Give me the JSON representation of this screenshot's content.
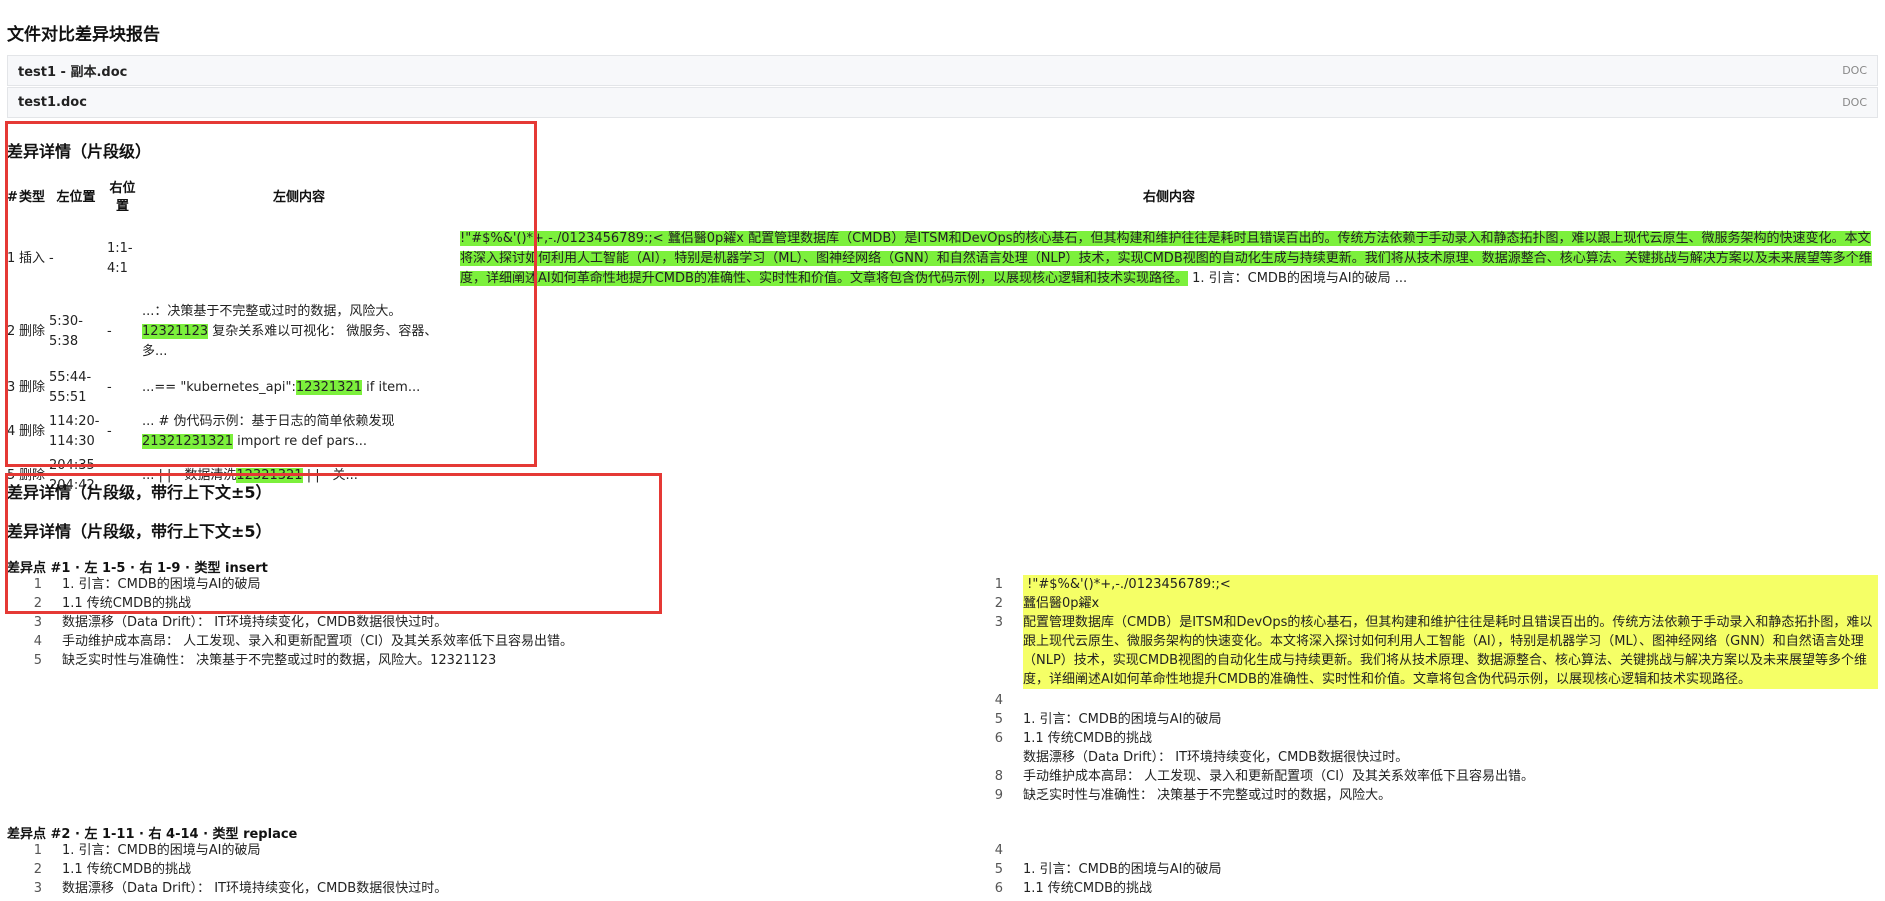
{
  "report": {
    "title": "文件对比差异块报告"
  },
  "files": [
    {
      "name": "test1 - 副本.doc",
      "type": "DOC"
    },
    {
      "name": "test1.doc",
      "type": "DOC"
    }
  ],
  "section1": {
    "title": "差异详情（片段级）",
    "headers": {
      "num": "#",
      "type": "类型",
      "left_pos": "左位置",
      "right_pos": "右位置",
      "left_content": "左侧内容",
      "right_content": "右侧内容"
    },
    "rows": [
      {
        "num": "1",
        "type": "插入",
        "left_pos": "-",
        "right_pos": "1:1-4:1",
        "left_pre": "",
        "left_hl": "",
        "left_post": "",
        "right_hl": "!\"#$%&'()*+,-./0123456789:;< 蠶侣醫0p糴x 配置管理数据库（CMDB）是ITSM和DevOps的核心基石，但其构建和维护往往是耗时且错误百出的。传统方法依赖于手动录入和静态拓扑图，难以跟上现代云原生、微服务架构的快速变化。本文将深入探讨如何利用人工智能（AI），特别是机器学习（ML）、图神经网络（GNN）和自然语言处理（NLP）技术，实现CMDB视图的自动化生成与持续更新。我们将从技术原理、数据源整合、核心算法、关键挑战与解决方案以及未来展望等多个维度，详细阐述AI如何革命性地提升CMDB的准确性、实时性和价值。文章将包含伪代码示例，以展现核心逻辑和技术实现路径。",
        "right_post": " 1. 引言：CMDB的困境与AI的破局 ..."
      },
      {
        "num": "2",
        "type": "删除",
        "left_pos": "5:30-5:38",
        "right_pos": "-",
        "left_pre": "...：决策基于不完整或过时的数据，风险大。",
        "left_hl": "12321123",
        "left_post": " 复杂关系难以可视化： 微服务、容器、多...",
        "right_hl": "",
        "right_post": ""
      },
      {
        "num": "3",
        "type": "删除",
        "left_pos": "55:44-55:51",
        "right_pos": "-",
        "left_pre": "...== \"kubernetes_api\":",
        "left_hl": "12321321",
        "left_post": " if item...",
        "right_hl": "",
        "right_post": ""
      },
      {
        "num": "4",
        "type": "删除",
        "left_pos": "114:20-114:30",
        "right_pos": "-",
        "left_pre": "... # 伪代码示例：基于日志的简单依赖发现 ",
        "left_hl": "21321231321",
        "left_post": " import re def pars...",
        "right_hl": "",
        "right_post": ""
      },
      {
        "num": "5",
        "type": "删除",
        "left_pos": "204:35-204:42",
        "right_pos": "-",
        "left_pre": "... | | - 数据清洗",
        "left_hl": "12321321",
        "left_post": " | | - 关...",
        "right_hl": "",
        "right_post": ""
      }
    ]
  },
  "section2": {
    "title": "差异详情（片段级，带行上下文±5）",
    "subtitle": "差异详情（片段级，带行上下文±5）",
    "points": [
      {
        "title": "差异点 #1 · 左 1-5 · 右 1-9 · 类型 insert",
        "left_lines": [
          {
            "n": "1",
            "t": "1. 引言：CMDB的困境与AI的破局"
          },
          {
            "n": "2",
            "t": "1.1 传统CMDB的挑战"
          },
          {
            "n": "3",
            "t": "数据漂移（Data Drift）： IT环境持续变化，CMDB数据很快过时。"
          },
          {
            "n": "4",
            "t": "手动维护成本高昂： 人工发现、录入和更新配置项（CI）及其关系效率低下且容易出错。"
          },
          {
            "n": "5",
            "t": "缺乏实时性与准确性： 决策基于不完整或过时的数据，风险大。12321123"
          }
        ],
        "right_lines": [
          {
            "n": "1",
            "t": " !\"#$%&'()*+,-./0123456789:;<",
            "hl": true
          },
          {
            "n": "2",
            "t": "蠶侣醫0p糴x",
            "hl": true
          },
          {
            "n": "3",
            "t": "配置管理数据库（CMDB）是ITSM和DevOps的核心基石，但其构建和维护往往是耗时且错误百出的。传统方法依赖于手动录入和静态拓扑图，难以跟上现代云原生、微服务架构的快速变化。本文将深入探讨如何利用人工智能（AI），特别是机器学习（ML）、图神经网络（GNN）和自然语言处理（NLP）技术，实现CMDB视图的自动化生成与持续更新。我们将从技术原理、数据源整合、核心算法、关键挑战与解决方案以及未来展望等多个维度，详细阐述AI如何革命性地提升CMDB的准确性、实时性和价值。文章将包含伪代码示例，以展现核心逻辑和技术实现路径。",
            "hl": true
          },
          {
            "n": "4",
            "t": ""
          },
          {
            "n": "5",
            "t": "1. 引言：CMDB的困境与AI的破局"
          },
          {
            "n": "6",
            "t": "1.1 传统CMDB的挑战"
          },
          {
            "n": "",
            "t": "数据漂移（Data Drift）： IT环境持续变化，CMDB数据很快过时。"
          },
          {
            "n": "8",
            "t": "手动维护成本高昂： 人工发现、录入和更新配置项（CI）及其关系效率低下且容易出错。"
          },
          {
            "n": "9",
            "t": "缺乏实时性与准确性： 决策基于不完整或过时的数据，风险大。"
          }
        ]
      },
      {
        "title": "差异点 #2 · 左 1-11 · 右 4-14 · 类型 replace",
        "left_lines": [
          {
            "n": "1",
            "t": "1. 引言：CMDB的困境与AI的破局"
          },
          {
            "n": "2",
            "t": "1.1 传统CMDB的挑战"
          },
          {
            "n": "3",
            "t": "数据漂移（Data Drift）： IT环境持续变化，CMDB数据很快过时。"
          }
        ],
        "right_lines": [
          {
            "n": "4",
            "t": ""
          },
          {
            "n": "5",
            "t": "1. 引言：CMDB的困境与AI的破局"
          },
          {
            "n": "6",
            "t": "1.1 传统CMDB的挑战"
          }
        ]
      }
    ]
  }
}
